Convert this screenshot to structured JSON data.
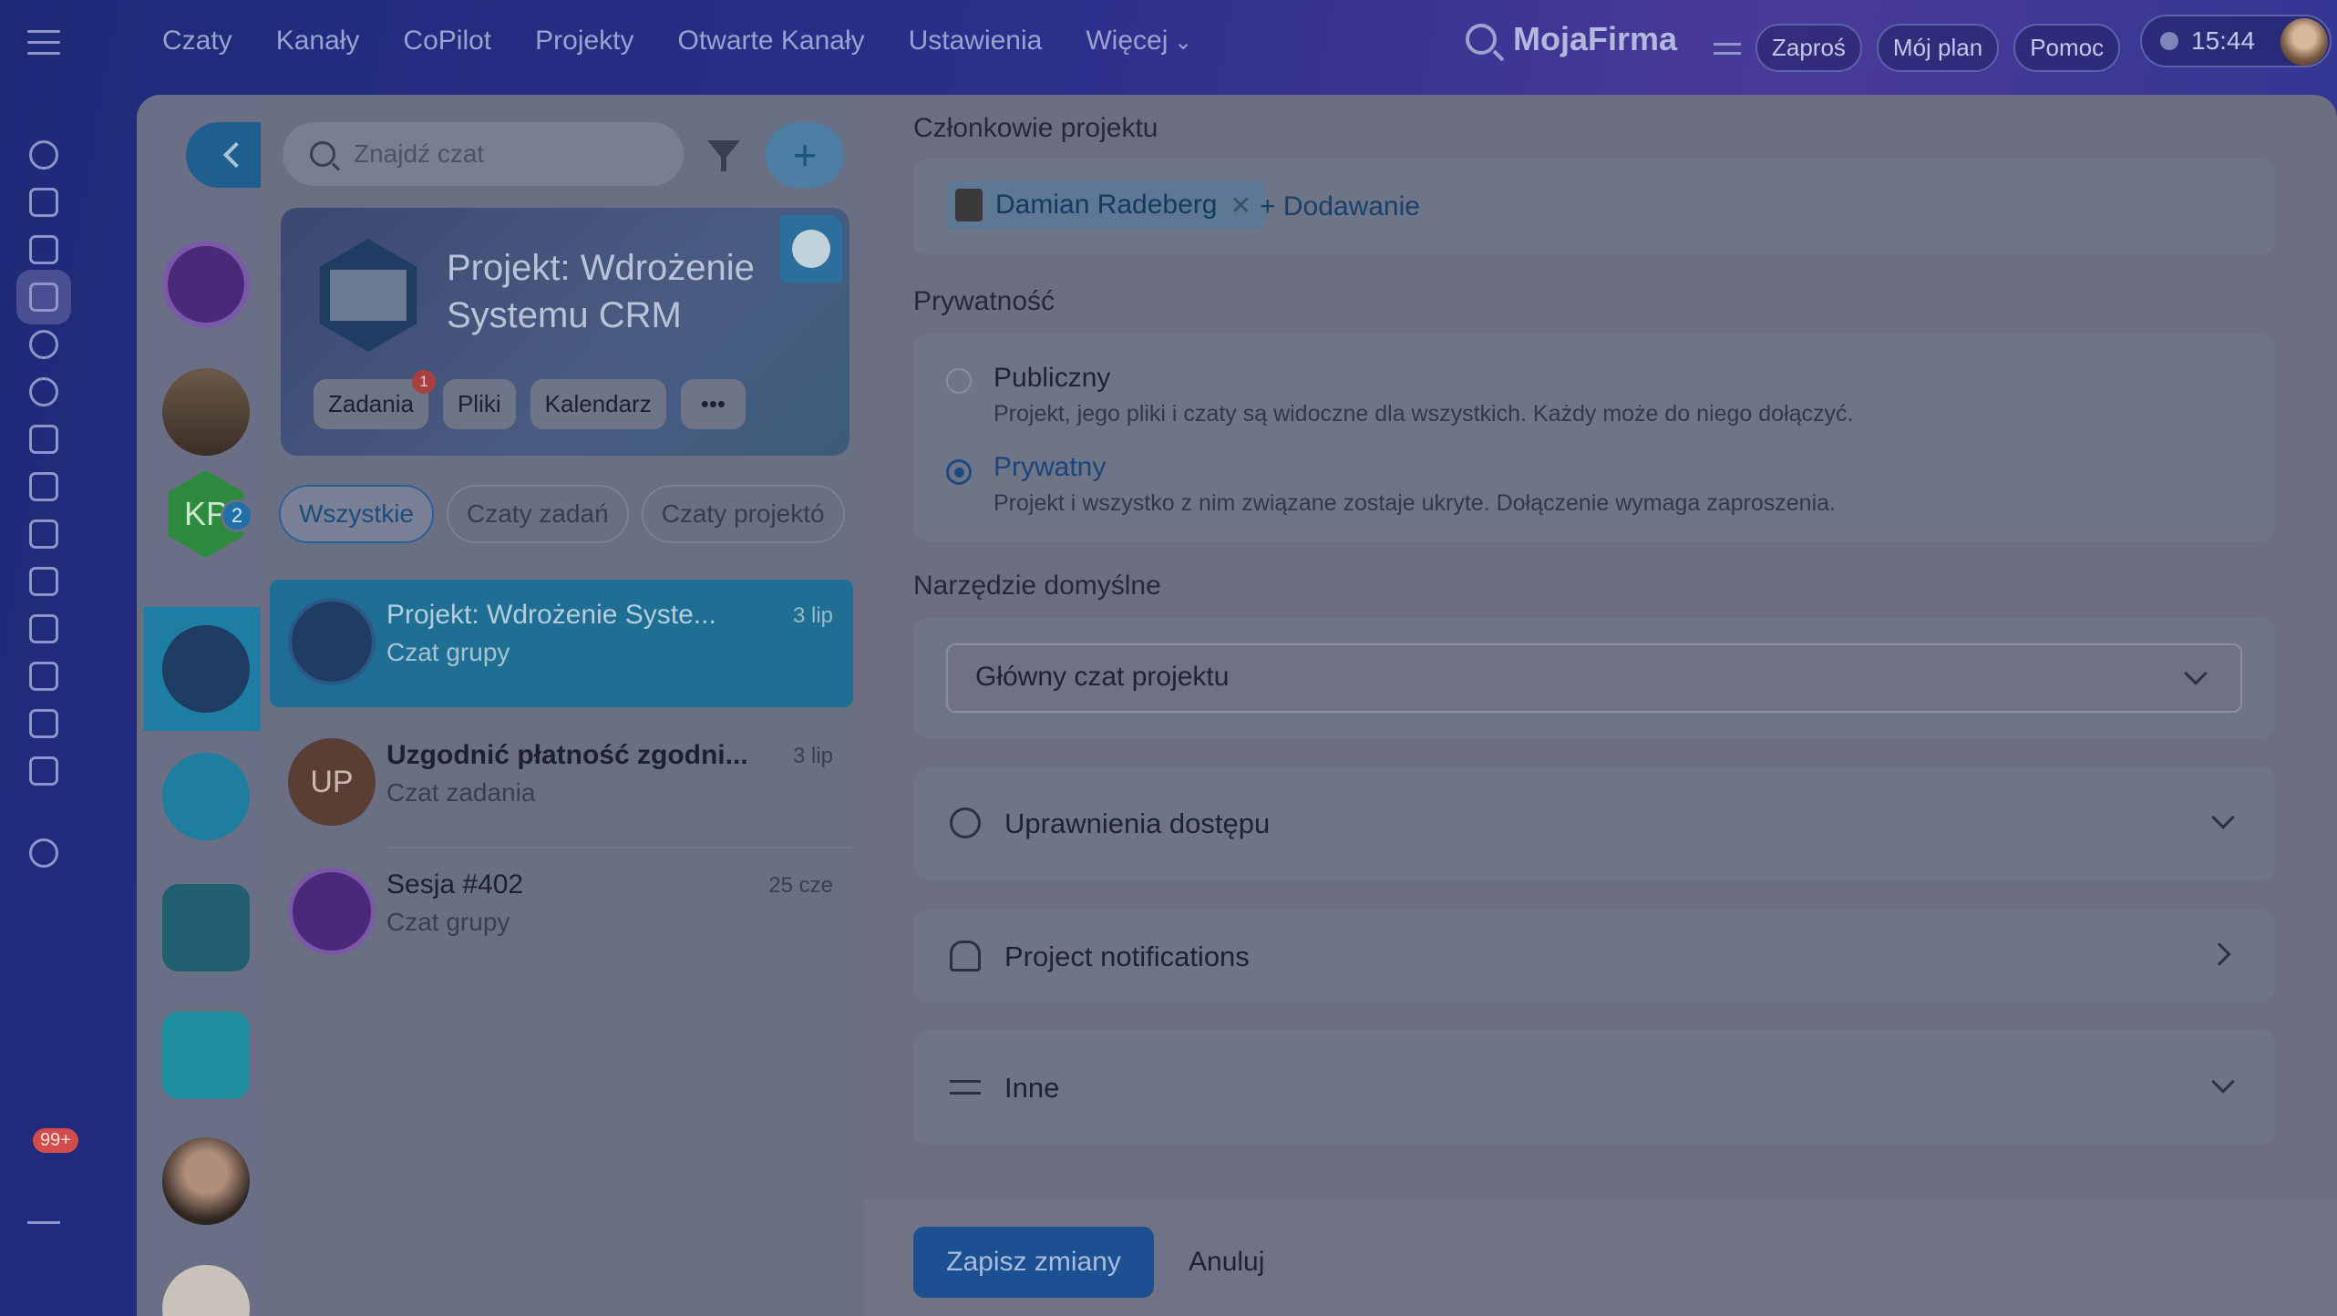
{
  "topnav": {
    "items": [
      "Czaty",
      "Kanały",
      "CoPilot",
      "Projekty",
      "Otwarte Kanały",
      "Ustawienia",
      "Więcej"
    ],
    "brand": "MojaFirma",
    "invite": "Zaproś",
    "plan": "Mój plan",
    "help": "Pomoc",
    "time": "15:44"
  },
  "rail": {
    "mail_badge": "99+"
  },
  "chatlist": {
    "search_placeholder": "Znajdź czat",
    "kp_initials": "KP",
    "kp_badge": "2",
    "project": {
      "title": "Projekt: Wdrożenie Systemu CRM",
      "buttons": [
        "Zadania",
        "Pliki",
        "Kalendarz"
      ],
      "tasks_badge": "1"
    },
    "filters": [
      "Wszystkie",
      "Czaty zadań",
      "Czaty projektó"
    ],
    "chats": [
      {
        "name": "Projekt: Wdrożenie Syste...",
        "sub": "Czat grupy",
        "date": "3 lip"
      },
      {
        "name": "Uzgodnić płatność zgodni...",
        "sub": "Czat zadania",
        "date": "3 lip",
        "initials": "UP"
      },
      {
        "name": "Sesja #402",
        "sub": "Czat grupy",
        "date": "25 cze"
      }
    ]
  },
  "settings": {
    "members_title": "Członkowie projektu",
    "member_name": "Damian Radeberg",
    "add_label": "+ Dodawanie",
    "privacy_title": "Prywatność",
    "public_label": "Publiczny",
    "public_desc": "Projekt, jego pliki i czaty są widoczne dla wszystkich. Każdy może do niego dołączyć.",
    "private_label": "Prywatny",
    "private_desc": "Projekt i wszystko z nim związane zostaje ukryte. Dołączenie wymaga zaproszenia.",
    "privacy_selected": "Prywatny",
    "tool_title": "Narzędzie domyślne",
    "tool_value": "Główny czat projektu",
    "access_label": "Uprawnienia dostępu",
    "notifications_label": "Project notifications",
    "other_label": "Inne",
    "save_label": "Zapisz zmiany",
    "cancel_label": "Anuluj"
  }
}
